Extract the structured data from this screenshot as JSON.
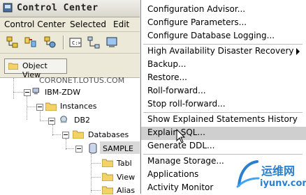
{
  "window": {
    "title": "Control Center"
  },
  "menubar": {
    "items": [
      "Control Center",
      "Selected",
      "Edit"
    ]
  },
  "viewbar": {
    "object_view_label": "Object View"
  },
  "tree": {
    "node_top_partial": "CORONET.LOTUS.COM",
    "node_system": "IBM-ZDW",
    "node_instances": "Instances",
    "node_db2": "DB2",
    "node_databases": "Databases",
    "node_sample": "SAMPLE",
    "node_tables_partial": "Tabl",
    "node_views_partial": "View",
    "node_alias_partial": "Alias"
  },
  "context_menu": {
    "items": [
      "Configuration Advisor...",
      "Configure Parameters...",
      "Configure Database Logging...",
      "High Availability Disaster Recovery",
      "Backup...",
      "Restore...",
      "Roll-forward...",
      "Stop roll-forward...",
      "Show Explained Statements History",
      "Explain SQL...",
      "Generate DDL...",
      "Manage Storage...",
      "Applications",
      "Activity Monitor"
    ],
    "highlighted_index": 9
  },
  "watermark": {
    "text_cn": "运维网",
    "text_url": "iyunv.com"
  },
  "colors": {
    "menu_highlight": "#cfcfcf",
    "watermark_blue": "#2a7fd0"
  }
}
